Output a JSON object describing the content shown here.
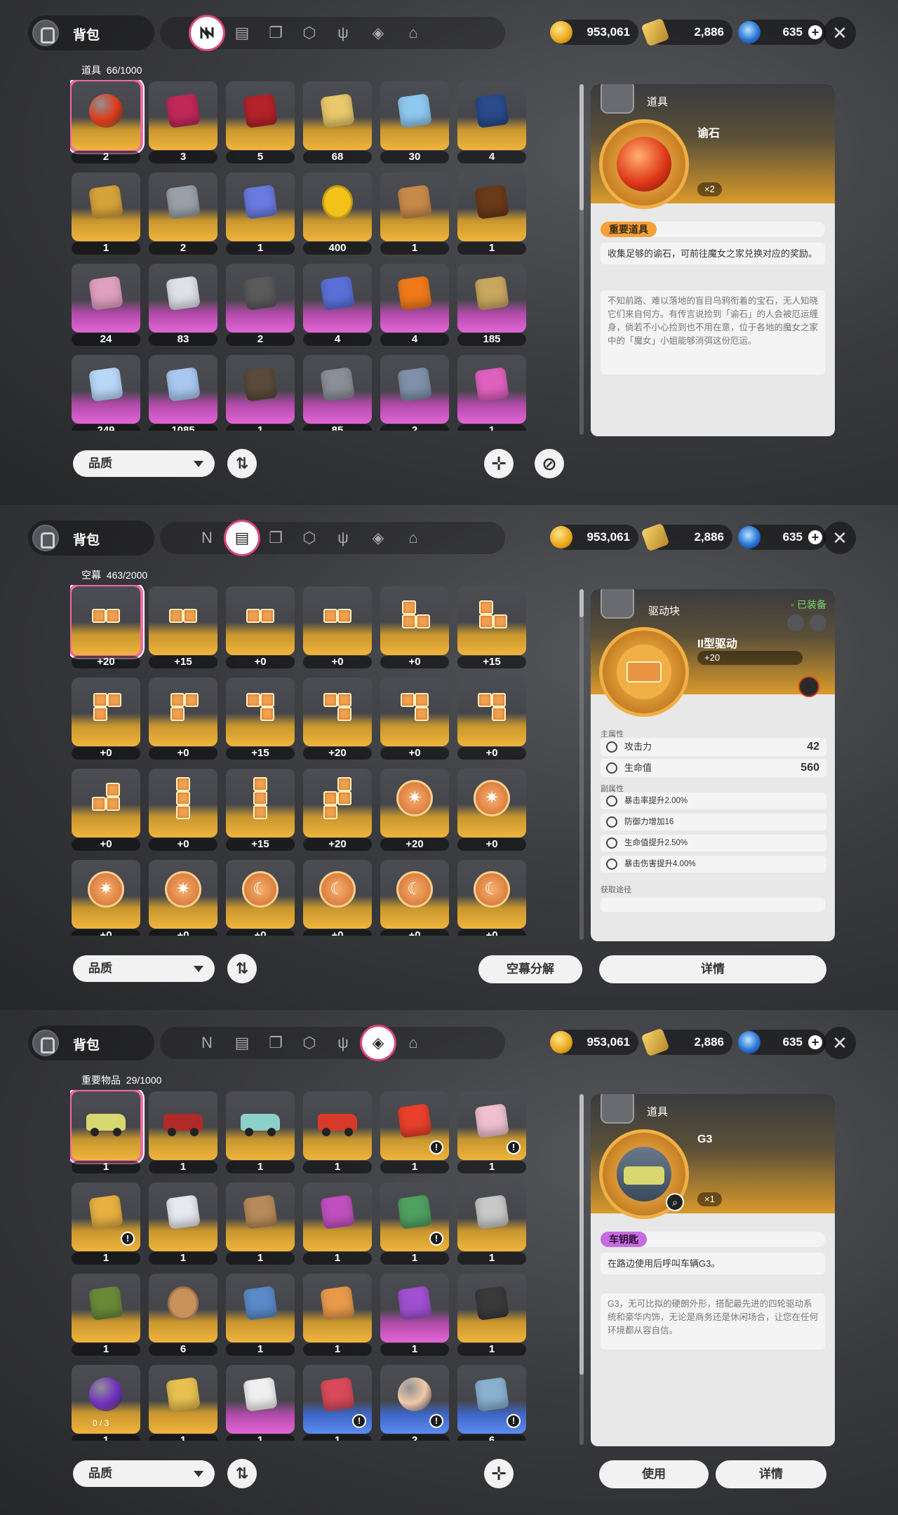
{
  "currencies": {
    "gold": "953,061",
    "ticket": "2,886",
    "gem": "635"
  },
  "bag_title": "背包",
  "tabs": [
    "tab-props",
    "tab-drive",
    "tab-books",
    "tab-box",
    "tab-food",
    "tab-key-items",
    "tab-home"
  ],
  "panels": [
    {
      "active_tab": 0,
      "category": "道具",
      "count": "66/1000",
      "items": [
        {
          "q": "2",
          "c": "gold",
          "color": "#e03a1a",
          "shape": "orb"
        },
        {
          "q": "3",
          "c": "gold",
          "color": "#c0285a",
          "shape": "seal"
        },
        {
          "q": "5",
          "c": "gold",
          "color": "#b4222a",
          "shape": "cape"
        },
        {
          "q": "68",
          "c": "gold",
          "color": "#e8c86a",
          "shape": "statue"
        },
        {
          "q": "30",
          "c": "gold",
          "color": "#8ec8f0",
          "shape": "card"
        },
        {
          "q": "4",
          "c": "gold",
          "color": "#2a4a8a",
          "shape": "spool"
        },
        {
          "q": "1",
          "c": "gold",
          "color": "#d6a23a",
          "shape": "belt"
        },
        {
          "q": "2",
          "c": "gold",
          "color": "#9aa0a8",
          "shape": "armor"
        },
        {
          "q": "1",
          "c": "gold",
          "color": "#6a7ae0",
          "shape": "ship"
        },
        {
          "q": "400",
          "c": "gold",
          "color": "#f3c21a",
          "shape": "coin"
        },
        {
          "q": "1",
          "c": "gold",
          "color": "#c88a4a",
          "shape": "hammer"
        },
        {
          "q": "1",
          "c": "gold",
          "color": "#6a3a1a",
          "shape": "box"
        },
        {
          "q": "24",
          "c": "purple",
          "color": "#e0a0c0",
          "shape": "bag"
        },
        {
          "q": "83",
          "c": "purple",
          "color": "#e0e0e8",
          "shape": "cards"
        },
        {
          "q": "2",
          "c": "purple",
          "color": "#5a5a5a",
          "shape": "tile"
        },
        {
          "q": "4",
          "c": "purple",
          "color": "#5a70d8",
          "shape": "gem"
        },
        {
          "q": "4",
          "c": "purple",
          "color": "#f07a1a",
          "shape": "fire"
        },
        {
          "q": "185",
          "c": "purple",
          "color": "#c8a860",
          "shape": "gift"
        },
        {
          "q": "249",
          "c": "purple",
          "color": "#b8d8f8",
          "shape": "crystal"
        },
        {
          "q": "1085",
          "c": "purple",
          "color": "#a8c8f0",
          "shape": "star"
        },
        {
          "q": "1",
          "c": "purple",
          "color": "#5a4a3a",
          "shape": "seed"
        },
        {
          "q": "85",
          "c": "purple",
          "color": "#8a8e98",
          "shape": "spool"
        },
        {
          "q": "2",
          "c": "purple",
          "color": "#8090a8",
          "shape": "armor"
        },
        {
          "q": "1",
          "c": "purple",
          "color": "#e060c0",
          "shape": "paint"
        }
      ],
      "detail": {
        "type_label": "道具",
        "name": "谕石",
        "count": "×2",
        "tag": "重要道具",
        "desc": "收集足够的谕石，可前往魔女之家兑换对应的奖励。",
        "lore": "不知前路、难以落地的盲目乌鸦衔着的宝石，无人知晓它们来自何方。有传言说捡到「谕石」的人会被厄运缠身，倘若不小心捡到也不用在意，位于各地的魔女之家中的「魔女」小姐能够消弭这份厄运。"
      }
    },
    {
      "active_tab": 1,
      "category": "空幕",
      "count": "463/2000",
      "items": [
        {
          "q": "+20",
          "c": "gold",
          "shape": "d2"
        },
        {
          "q": "+15",
          "c": "gold",
          "shape": "d2"
        },
        {
          "q": "+0",
          "c": "gold",
          "shape": "d2"
        },
        {
          "q": "+0",
          "c": "gold",
          "shape": "d2"
        },
        {
          "q": "+0",
          "c": "gold",
          "shape": "dL"
        },
        {
          "q": "+15",
          "c": "gold",
          "shape": "dL"
        },
        {
          "q": "+0",
          "c": "gold",
          "shape": "dL2"
        },
        {
          "q": "+0",
          "c": "gold",
          "shape": "dL2"
        },
        {
          "q": "+15",
          "c": "gold",
          "shape": "dJ"
        },
        {
          "q": "+20",
          "c": "gold",
          "shape": "dJ"
        },
        {
          "q": "+0",
          "c": "gold",
          "shape": "dJ"
        },
        {
          "q": "+0",
          "c": "gold",
          "shape": "dJ"
        },
        {
          "q": "+0",
          "c": "gold",
          "shape": "dS"
        },
        {
          "q": "+0",
          "c": "gold",
          "shape": "dI"
        },
        {
          "q": "+15",
          "c": "gold",
          "shape": "dI"
        },
        {
          "q": "+20",
          "c": "gold",
          "shape": "dZ"
        },
        {
          "q": "+20",
          "c": "gold",
          "shape": "disc"
        },
        {
          "q": "+0",
          "c": "gold",
          "shape": "disc"
        },
        {
          "q": "+0",
          "c": "gold",
          "shape": "disc"
        },
        {
          "q": "+0",
          "c": "gold",
          "shape": "disc"
        },
        {
          "q": "+0",
          "c": "gold",
          "shape": "moon"
        },
        {
          "q": "+0",
          "c": "gold",
          "shape": "moon"
        },
        {
          "q": "+0",
          "c": "gold",
          "shape": "moon"
        },
        {
          "q": "+0",
          "c": "gold",
          "shape": "moon"
        }
      ],
      "detail": {
        "type_label": "驱动块",
        "equipped": "已装备",
        "name": "II型驱动",
        "level": "+20",
        "main_label": "主属性",
        "main_stats": [
          {
            "name": "攻击力",
            "val": "42"
          },
          {
            "name": "生命值",
            "val": "560"
          }
        ],
        "sub_label": "副属性",
        "sub_stats": [
          "暴击率提升2.00%",
          "防御力增加16",
          "生命值提升2.50%",
          "暴击伤害提升4.00%"
        ],
        "source_label": "获取途径"
      },
      "buttons": {
        "decompose": "空幕分解",
        "details": "详情"
      }
    },
    {
      "active_tab": 5,
      "category": "重要物品",
      "count": "29/1000",
      "items": [
        {
          "q": "1",
          "c": "gold",
          "color": "#d8d870",
          "shape": "car"
        },
        {
          "q": "1",
          "c": "gold",
          "color": "#b02a2a",
          "shape": "car"
        },
        {
          "q": "1",
          "c": "gold",
          "color": "#8ad0c8",
          "shape": "car"
        },
        {
          "q": "1",
          "c": "gold",
          "color": "#d83a2a",
          "shape": "scooter"
        },
        {
          "q": "1",
          "c": "gold",
          "color": "#e8402a",
          "shape": "drink",
          "badge": "!"
        },
        {
          "q": "1",
          "c": "gold",
          "color": "#f0c0d0",
          "shape": "icecream",
          "badge": "!"
        },
        {
          "q": "1",
          "c": "gold",
          "color": "#e8b040",
          "shape": "helmet",
          "badge": "!"
        },
        {
          "q": "1",
          "c": "gold",
          "color": "#e8e8f0",
          "shape": "photos"
        },
        {
          "q": "1",
          "c": "gold",
          "color": "#b88a5a",
          "shape": "book"
        },
        {
          "q": "1",
          "c": "gold",
          "color": "#c050c0",
          "shape": "tube"
        },
        {
          "q": "1",
          "c": "gold",
          "color": "#50a060",
          "shape": "clip",
          "badge": "!"
        },
        {
          "q": "1",
          "c": "gold",
          "color": "#c8c8c8",
          "shape": "key"
        },
        {
          "q": "1",
          "c": "gold",
          "color": "#6a8a3a",
          "shape": "wreath"
        },
        {
          "q": "6",
          "c": "gold",
          "color": "#c8905a",
          "shape": "coin"
        },
        {
          "q": "1",
          "c": "gold",
          "color": "#5a8ac8",
          "shape": "photos"
        },
        {
          "q": "1",
          "c": "gold",
          "color": "#e89a4a",
          "shape": "photos"
        },
        {
          "q": "1",
          "c": "purple",
          "color": "#a050d0",
          "shape": "player"
        },
        {
          "q": "1",
          "c": "gold",
          "color": "#3a3a3a",
          "shape": "flag"
        },
        {
          "q": "1",
          "c": "gold",
          "color": "#7030c0",
          "shape": "ball",
          "sub": "0 / 3"
        },
        {
          "q": "1",
          "c": "gold",
          "color": "#e8c050",
          "shape": "cube"
        },
        {
          "q": "1",
          "c": "purple",
          "color": "#f0f0f0",
          "shape": "notebook"
        },
        {
          "q": "1",
          "c": "blue",
          "color": "#d84a5a",
          "shape": "poster",
          "badge": "!"
        },
        {
          "q": "2",
          "c": "blue",
          "color": "#f0c8a8",
          "shape": "egg",
          "badge": "!"
        },
        {
          "q": "6",
          "c": "blue",
          "color": "#8ab0d0",
          "shape": "tickets",
          "badge": "!"
        }
      ],
      "detail": {
        "type_label": "道具",
        "name": "G3",
        "count": "×1",
        "tag": "车钥匙",
        "desc": "在路边使用后呼叫车辆G3。",
        "lore": "G3，无可比拟的硬朗外形，搭配最先进的四轮驱动系统和豪华内饰，无论是商务还是休闲场合，让您在任何环境都从容自信。"
      },
      "buttons": {
        "use": "使用",
        "details": "详情"
      }
    }
  ],
  "quality_label": "品质",
  "colors": {
    "accent_pink": "#f06aa0",
    "gold_bg": "#f0b43c",
    "purple_bg": "#e265d6",
    "blue_bg": "#5a8cf0"
  }
}
